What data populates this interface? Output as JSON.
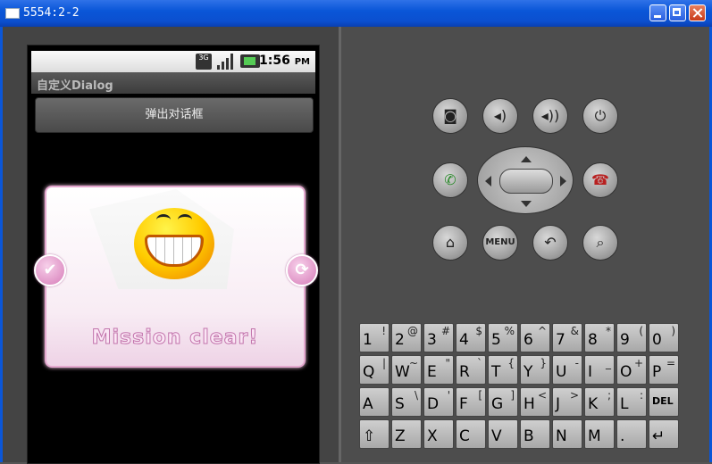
{
  "window": {
    "title": "5554:2-2"
  },
  "status_bar": {
    "time": "1:56",
    "ampm": "PM",
    "network": "3G"
  },
  "app": {
    "title": "自定义Dialog",
    "popup_button": "弹出对话框"
  },
  "dialog": {
    "caption": "Mission clear!",
    "left_icon": "check-icon",
    "right_icon": "refresh-icon"
  },
  "controls": {
    "menu_label": "MENU"
  },
  "keyboard": {
    "rows": [
      [
        [
          "1",
          "!"
        ],
        [
          "2",
          "@"
        ],
        [
          "3",
          "#"
        ],
        [
          "4",
          "$"
        ],
        [
          "5",
          "%"
        ],
        [
          "6",
          "^"
        ],
        [
          "7",
          "&"
        ],
        [
          "8",
          "*"
        ],
        [
          "9",
          "("
        ],
        [
          "0",
          ")"
        ]
      ],
      [
        [
          "Q",
          "|"
        ],
        [
          "W",
          "~"
        ],
        [
          "E",
          "\""
        ],
        [
          "R",
          "`"
        ],
        [
          "T",
          "{"
        ],
        [
          "Y",
          "}"
        ],
        [
          "U",
          "-"
        ],
        [
          "I",
          "_"
        ],
        [
          "O",
          "+"
        ],
        [
          "P",
          "="
        ]
      ],
      [
        [
          "A",
          ""
        ],
        [
          "S",
          "\\"
        ],
        [
          "D",
          "'"
        ],
        [
          "F",
          "["
        ],
        [
          "G",
          "]"
        ],
        [
          "H",
          "<"
        ],
        [
          "J",
          ">"
        ],
        [
          "K",
          ";"
        ],
        [
          "L",
          ":"
        ],
        [
          "DEL",
          ""
        ]
      ],
      [
        [
          "⇧",
          ""
        ],
        [
          "Z",
          ""
        ],
        [
          "X",
          ""
        ],
        [
          "C",
          ""
        ],
        [
          "V",
          ""
        ],
        [
          "B",
          ""
        ],
        [
          "N",
          ""
        ],
        [
          "M",
          ""
        ],
        [
          ".",
          ""
        ],
        [
          "↵",
          ""
        ]
      ]
    ]
  }
}
